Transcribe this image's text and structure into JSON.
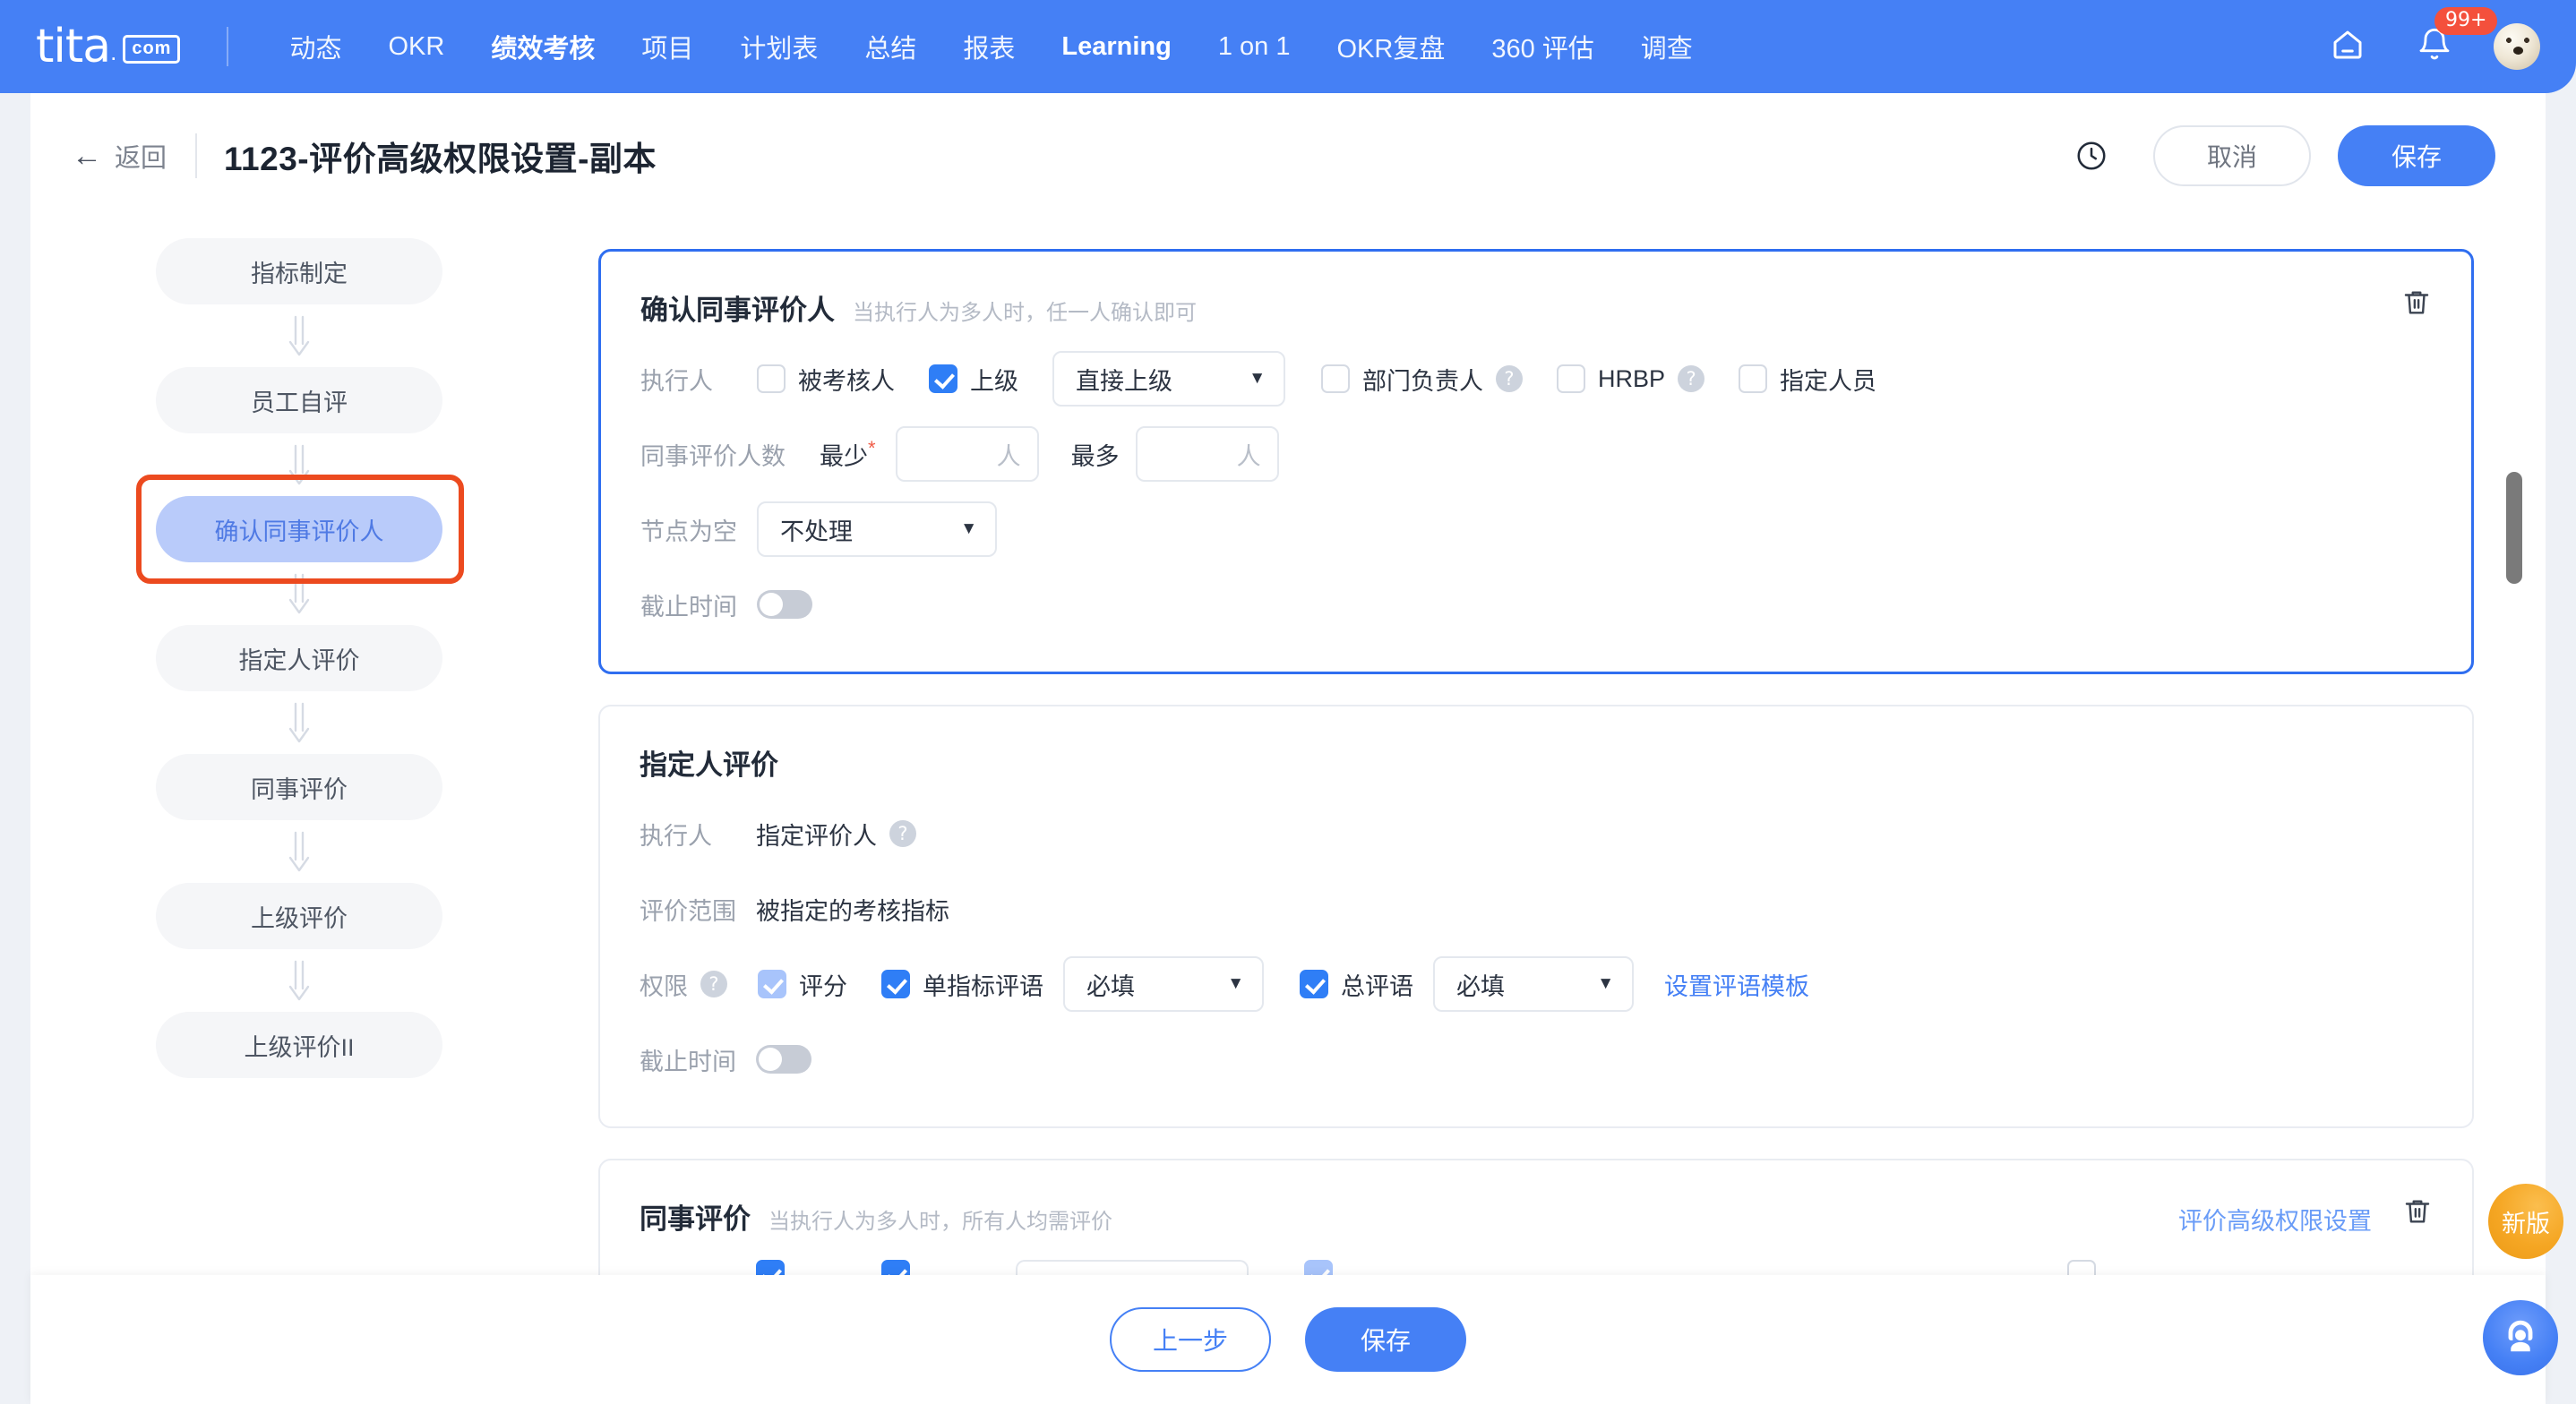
{
  "topnav": {
    "brand": "tita",
    "brand_suffix": "com",
    "items": [
      {
        "label": "动态",
        "active": false
      },
      {
        "label": "OKR",
        "active": false
      },
      {
        "label": "绩效考核",
        "active": true
      },
      {
        "label": "项目",
        "active": false
      },
      {
        "label": "计划表",
        "active": false
      },
      {
        "label": "总结",
        "active": false
      },
      {
        "label": "报表",
        "active": false
      },
      {
        "label": "Learning",
        "active": true
      },
      {
        "label": "1 on 1",
        "active": false
      },
      {
        "label": "OKR复盘",
        "active": false
      },
      {
        "label": "360 评估",
        "active": false
      },
      {
        "label": "调查",
        "active": false
      }
    ],
    "home_icon": "home-icon",
    "bell_icon": "bell-icon",
    "notification_count": "99+",
    "avatar": "user-avatar"
  },
  "header": {
    "back_label": "返回",
    "back_icon": "arrow-left-icon",
    "title": "1123-评价高级权限设置-副本",
    "history_icon": "clock-icon",
    "cancel_label": "取消",
    "save_label": "保存"
  },
  "steps": [
    {
      "label": "指标制定",
      "current": false
    },
    {
      "label": "员工自评",
      "current": false
    },
    {
      "label": "确认同事评价人",
      "current": true,
      "highlighted": true
    },
    {
      "label": "指定人评价",
      "current": false
    },
    {
      "label": "同事评价",
      "current": false
    },
    {
      "label": "上级评价",
      "current": false
    },
    {
      "label": "上级评价II",
      "current": false
    }
  ],
  "cards": [
    {
      "title": "确认同事评价人",
      "subtitle": "当执行人为多人时，任一人确认即可",
      "delete_icon": "trash-icon",
      "executor_label": "执行人",
      "executor_options": [
        {
          "label": "被考核人",
          "checked": false
        },
        {
          "label": "上级",
          "checked": true
        },
        {
          "label": "部门负责人",
          "checked": false,
          "help": "?"
        },
        {
          "label": "HRBP",
          "checked": false,
          "help": "?"
        },
        {
          "label": "指定人员",
          "checked": false
        }
      ],
      "superior_select": "直接上级",
      "count_label": "同事评价人数",
      "min_label": "最少",
      "min_required": "*",
      "min_value": "",
      "min_unit": "人",
      "max_label": "最多",
      "max_value": "",
      "max_unit": "人",
      "empty_node_label": "节点为空",
      "empty_node_select": "不处理",
      "deadline_label": "截止时间",
      "deadline_on": false
    },
    {
      "title": "指定人评价",
      "subtitle": "",
      "executor_label": "执行人",
      "executor_value": "指定评价人",
      "executor_help": "?",
      "scope_label": "评价范围",
      "scope_value": "被指定的考核指标",
      "permission_label": "权限",
      "permission_help": "?",
      "score_label": "评分",
      "score_checked": true,
      "single_comment_label": "单指标评语",
      "single_comment_checked": true,
      "single_comment_select": "必填",
      "total_comment_label": "总评语",
      "total_comment_checked": true,
      "total_comment_select": "必填",
      "template_link": "设置评语模板",
      "deadline_label": "截止时间",
      "deadline_on": false
    },
    {
      "title": "同事评价",
      "subtitle": "当执行人为多人时，所有人均需评价",
      "advanced_link": "评价高级权限设置",
      "delete_icon": "trash-icon"
    }
  ],
  "footer": {
    "prev_label": "上一步",
    "save_label": "保存"
  },
  "floating": {
    "new_version_label": "新版",
    "support_icon": "headset-support-icon"
  }
}
